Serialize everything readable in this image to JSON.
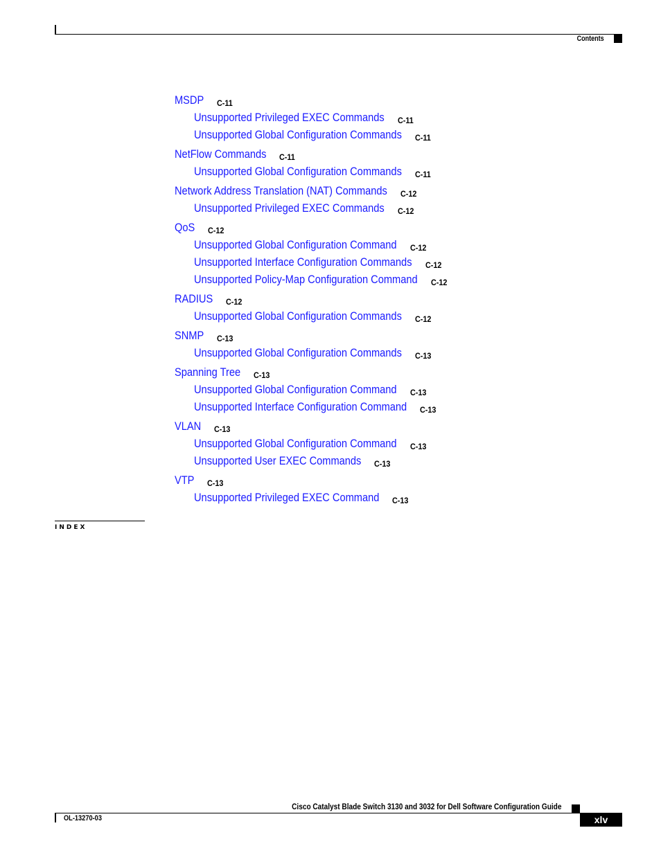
{
  "header": {
    "section_label": "Contents"
  },
  "toc": [
    {
      "level": 1,
      "title": "MSDP",
      "page": "C-11"
    },
    {
      "level": 2,
      "title": "Unsupported Privileged EXEC Commands",
      "page": "C-11"
    },
    {
      "level": 2,
      "title": "Unsupported Global Configuration Commands",
      "page": "C-11"
    },
    {
      "level": 1,
      "title": "NetFlow Commands",
      "page": "C-11"
    },
    {
      "level": 2,
      "title": "Unsupported Global Configuration Commands",
      "page": "C-11"
    },
    {
      "level": 1,
      "title": "Network Address Translation (NAT) Commands",
      "page": "C-12"
    },
    {
      "level": 2,
      "title": "Unsupported Privileged EXEC Commands",
      "page": "C-12"
    },
    {
      "level": 1,
      "title": "QoS",
      "page": "C-12"
    },
    {
      "level": 2,
      "title": "Unsupported Global Configuration Command",
      "page": "C-12"
    },
    {
      "level": 2,
      "title": "Unsupported Interface Configuration Commands",
      "page": "C-12"
    },
    {
      "level": 2,
      "title": "Unsupported Policy-Map Configuration Command",
      "page": "C-12"
    },
    {
      "level": 1,
      "title": "RADIUS",
      "page": "C-12"
    },
    {
      "level": 2,
      "title": "Unsupported Global Configuration Commands",
      "page": "C-12"
    },
    {
      "level": 1,
      "title": "SNMP",
      "page": "C-13"
    },
    {
      "level": 2,
      "title": "Unsupported Global Configuration Commands",
      "page": "C-13"
    },
    {
      "level": 1,
      "title": "Spanning Tree",
      "page": "C-13"
    },
    {
      "level": 2,
      "title": "Unsupported Global Configuration Command",
      "page": "C-13"
    },
    {
      "level": 2,
      "title": "Unsupported Interface Configuration Command",
      "page": "C-13"
    },
    {
      "level": 1,
      "title": "VLAN",
      "page": "C-13"
    },
    {
      "level": 2,
      "title": "Unsupported Global Configuration Command",
      "page": "C-13"
    },
    {
      "level": 2,
      "title": "Unsupported User EXEC Commands",
      "page": "C-13"
    },
    {
      "level": 1,
      "title": "VTP",
      "page": "C-13"
    },
    {
      "level": 2,
      "title": "Unsupported Privileged EXEC Command",
      "page": "C-13"
    }
  ],
  "index_label": "INDEX",
  "footer": {
    "guide_title": "Cisco Catalyst Blade Switch 3130 and 3032 for Dell Software Configuration Guide",
    "doc_number": "OL-13270-03",
    "page_number": "xlv"
  },
  "colors": {
    "link": "#1a1aff",
    "text": "#000000"
  }
}
